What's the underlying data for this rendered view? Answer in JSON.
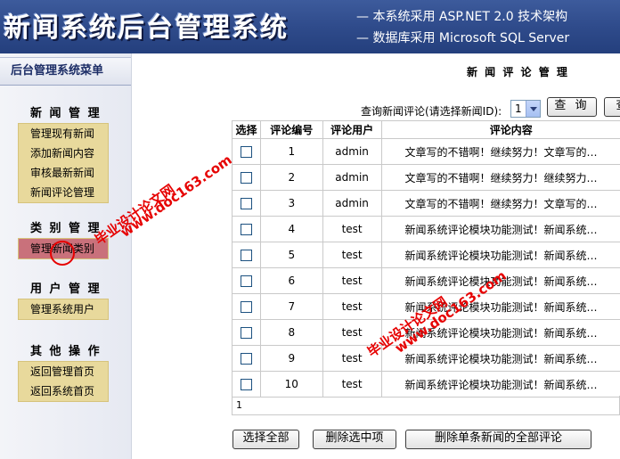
{
  "header": {
    "title": "新闻系统后台管理系统",
    "tagline1": "— 本系统采用 ASP.NET 2.0 技术架构",
    "tagline2": "— 数据库采用 Microsoft SQL Server"
  },
  "sidebar": {
    "menu_title": "后台管理系统菜单",
    "groups": [
      {
        "title": "新 闻 管 理",
        "items": [
          "管理现有新闻",
          "添加新闻内容",
          "审核最新新闻",
          "新闻评论管理"
        ]
      },
      {
        "title": "类 别 管 理",
        "items": [
          "管理新闻类别"
        ]
      },
      {
        "title": "用 户 管 理",
        "items": [
          "管理系统用户"
        ]
      },
      {
        "title": "其 他 操 作",
        "items": [
          "返回管理首页",
          "返回系统首页"
        ]
      }
    ]
  },
  "main": {
    "title": "新 闻 评 论 管 理",
    "query_label": "查询新闻评论(请选择新闻ID):",
    "selected_news_id": "1",
    "query_button": "查 询",
    "query_button2": "查",
    "table": {
      "headers": [
        "选择",
        "评论编号",
        "评论用户",
        "评论内容"
      ],
      "rows": [
        {
          "id": "1",
          "user": "admin",
          "content": "文章写的不错啊！继续努力！文章写的…"
        },
        {
          "id": "2",
          "user": "admin",
          "content": "文章写的不错啊！继续努力！继续努力…"
        },
        {
          "id": "3",
          "user": "admin",
          "content": "文章写的不错啊！继续努力！文章写的…"
        },
        {
          "id": "4",
          "user": "test",
          "content": "新闻系统评论模块功能测试！新闻系统…"
        },
        {
          "id": "5",
          "user": "test",
          "content": "新闻系统评论模块功能测试！新闻系统…"
        },
        {
          "id": "6",
          "user": "test",
          "content": "新闻系统评论模块功能测试！新闻系统…"
        },
        {
          "id": "7",
          "user": "test",
          "content": "新闻系统评论模块功能测试！新闻系统…"
        },
        {
          "id": "8",
          "user": "test",
          "content": "新闻系统评论模块功能测试！新闻系统…"
        },
        {
          "id": "9",
          "user": "test",
          "content": "新闻系统评论模块功能测试！新闻系统…"
        },
        {
          "id": "10",
          "user": "test",
          "content": "新闻系统评论模块功能测试！新闻系统…"
        }
      ],
      "pager": "1"
    },
    "buttons": {
      "select_all": "选择全部",
      "delete_selected": "删除选中项",
      "delete_all_for_news": "删除单条新闻的全部评论"
    }
  },
  "watermark": {
    "text_cn": "毕业设计论文网",
    "text_url": "www.doc163.com"
  }
}
